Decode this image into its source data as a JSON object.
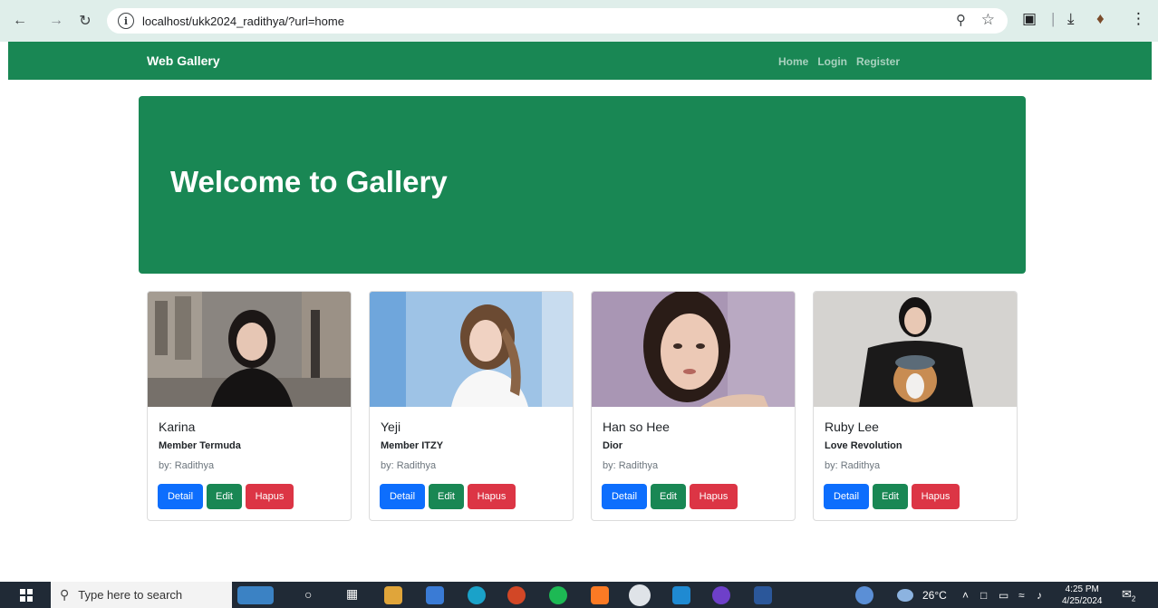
{
  "browser": {
    "url": "localhost/ukk2024_radithya/?url=home"
  },
  "navbar": {
    "brand": "Web Gallery",
    "links": [
      "Home",
      "Login",
      "Register"
    ]
  },
  "hero": {
    "title": "Welcome to Gallery"
  },
  "cards": [
    {
      "title": "Karina",
      "subtitle": "Member Termuda",
      "by": "by: Radithya",
      "photo_icon": "photo-karina"
    },
    {
      "title": "Yeji",
      "subtitle": "Member ITZY",
      "by": "by: Radithya",
      "photo_icon": "photo-yeji"
    },
    {
      "title": "Han so Hee",
      "subtitle": "Dior",
      "by": "by: Radithya",
      "photo_icon": "photo-han-so-hee"
    },
    {
      "title": "Ruby Lee",
      "subtitle": "Love Revolution",
      "by": "by: Radithya",
      "photo_icon": "photo-ruby-lee"
    }
  ],
  "buttons": {
    "detail": "Detail",
    "edit": "Edit",
    "hapus": "Hapus"
  },
  "taskbar": {
    "search_placeholder": "Type here to search",
    "temperature": "26°C",
    "time": "4:25 PM",
    "date": "4/25/2024",
    "notification_count": "2"
  },
  "colors": {
    "primary_green": "#198754",
    "detail_blue": "#0d6efd",
    "hapus_red": "#dc3545"
  }
}
